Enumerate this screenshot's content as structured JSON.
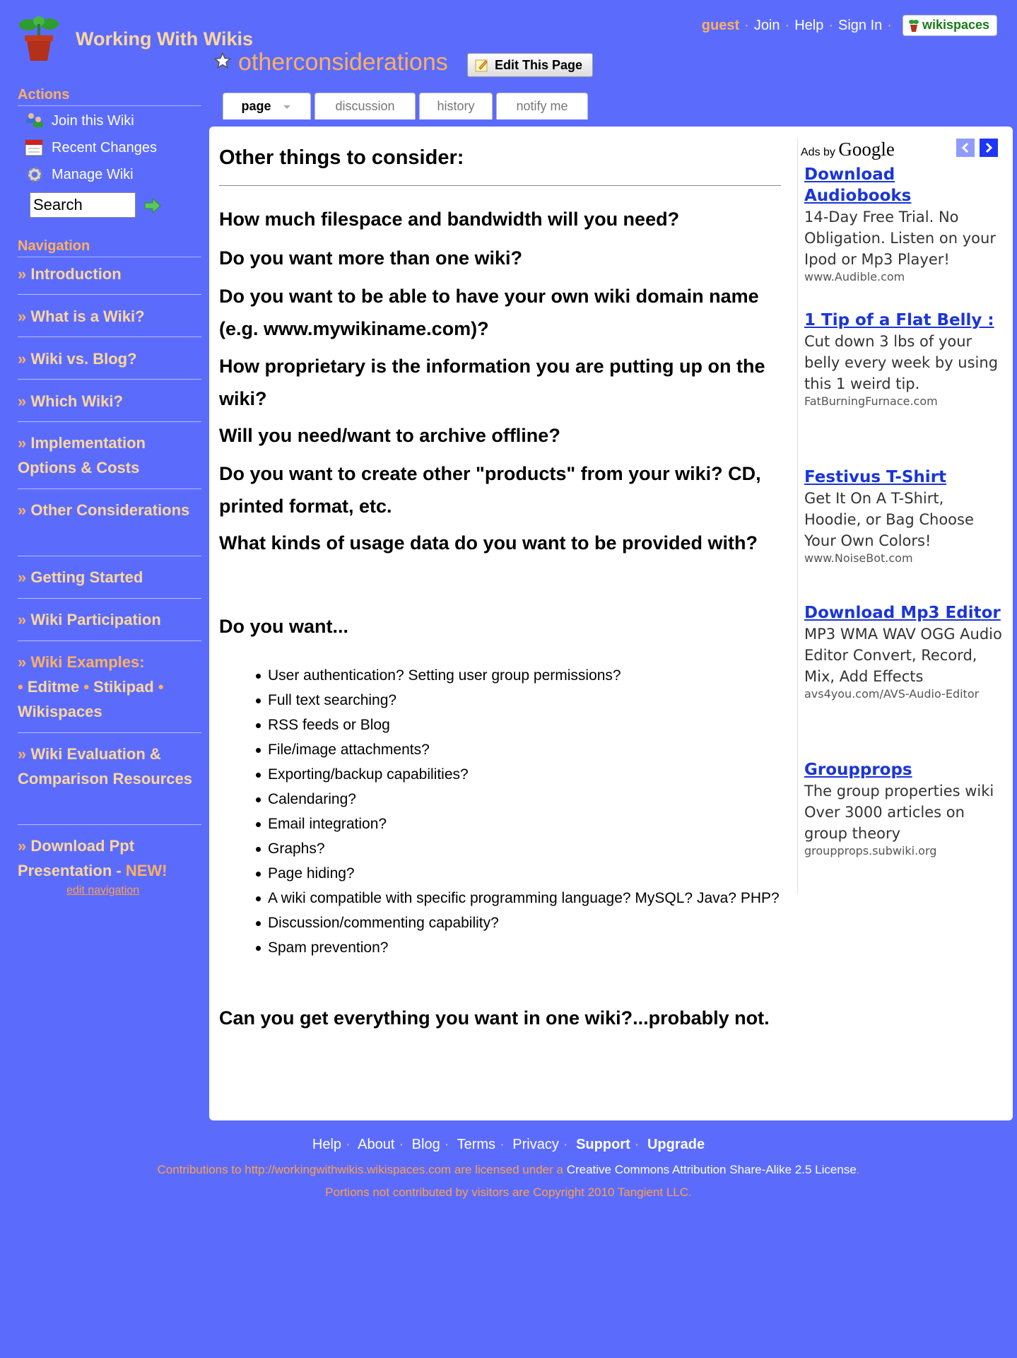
{
  "header": {
    "site_title": "Working With Wikis",
    "guest": "guest",
    "join": "Join",
    "help": "Help",
    "sign_in": "Sign In",
    "wikispaces": "wikispaces",
    "page_name": "otherconsiderations",
    "edit_button": "Edit This Page"
  },
  "sidebar": {
    "actions_heading": "Actions",
    "actions": [
      {
        "label": "Join this Wiki",
        "icon": "people-icon"
      },
      {
        "label": "Recent Changes",
        "icon": "calendar-icon"
      },
      {
        "label": "Manage Wiki",
        "icon": "gear-icon"
      }
    ],
    "search_value": "Search",
    "navigation_heading": "Navigation",
    "nav": [
      {
        "arrow": "»",
        "label": "Introduction"
      },
      {
        "arrow": "»",
        "label": "What is a Wiki?"
      },
      {
        "arrow": "»",
        "label": "Wiki vs. Blog?"
      },
      {
        "arrow": "»",
        "label": "Which Wiki?"
      },
      {
        "arrow": "»",
        "label": "Implementation Options & Costs"
      },
      {
        "arrow": "»",
        "label": "Other Considerations"
      },
      {
        "arrow": "»",
        "label": "Getting Started"
      },
      {
        "arrow": "»",
        "label": "Wiki Participation"
      },
      {
        "arrow": "»",
        "label": "Wiki Examples:"
      },
      {
        "arrow": "»",
        "label": "Wiki Evaluation & Comparison Resources"
      },
      {
        "arrow": "»",
        "label": "Download Ppt Presentation - "
      }
    ],
    "examples": [
      "Editme",
      "Stikipad",
      "Wikispaces"
    ],
    "bullet": "•",
    "new_badge": "NEW!",
    "edit_navigation": "edit navigation"
  },
  "tabs": [
    {
      "label": "page",
      "active": true
    },
    {
      "label": "discussion",
      "active": false
    },
    {
      "label": "history",
      "active": false
    },
    {
      "label": "notify me",
      "active": false
    }
  ],
  "main": {
    "heading": "Other things to consider:",
    "questions": [
      "How much filespace and bandwidth will you need?",
      "Do you want more than one wiki?",
      "Do you want to be able to have your own wiki domain name (e.g. www.mywikiname.com)?",
      "How proprietary is the information you are putting up on the wiki?",
      "Will you need/want to archive offline?",
      "Do you want to create other \"products\" from your wiki? CD, printed format, etc.",
      "What kinds of usage data do you want to be provided with?"
    ],
    "do_you_want": "Do you want...",
    "bullets": [
      "User authentication? Setting user group permissions?",
      "Full text searching?",
      "RSS feeds or Blog",
      "File/image attachments?",
      "Exporting/backup capabilities?",
      "Calendaring?",
      "Email integration?",
      "Graphs?",
      "Page hiding?",
      "A wiki compatible with specific programming language? MySQL? Java? PHP?",
      "Discussion/commenting capability?",
      "Spam prevention?"
    ],
    "closing": "Can you get everything you want in one wiki?...probably not."
  },
  "ads": {
    "ads_by": "Ads by",
    "google": "Google",
    "items": [
      {
        "title": "Download Audiobooks",
        "desc": "14-Day Free Trial. No Obligation. Listen on your Ipod or Mp3 Player!",
        "url": "www.Audible.com"
      },
      {
        "title": "1 Tip of a Flat Belly :",
        "desc": "Cut down 3 lbs of your belly every week by using this 1 weird tip.",
        "url": "FatBurningFurnace.com"
      },
      {
        "title": "Festivus T-Shirt",
        "desc": "Get It On A T-Shirt, Hoodie, or Bag Choose Your Own Colors!",
        "url": "www.NoiseBot.com"
      },
      {
        "title": "Download Mp3 Editor",
        "desc": "MP3 WMA WAV OGG Audio Editor Convert, Record, Mix, Add Effects",
        "url": "avs4you.com/AVS-Audio-Editor"
      },
      {
        "title": "Groupprops",
        "desc": "The group properties wiki Over 3000 articles on group theory",
        "url": "groupprops.subwiki.org"
      }
    ]
  },
  "footer": {
    "links": [
      "Help",
      "About",
      "Blog",
      "Terms",
      "Privacy",
      "Support",
      "Upgrade"
    ],
    "license_prefix": "Contributions to http://workingwithwikis.wikispaces.com are licensed under a ",
    "license_link": "Creative Commons Attribution Share-Alike 2.5 License",
    "license_suffix": ".",
    "copyright": "Portions not contributed by visitors are Copyright 2010 Tangient LLC."
  },
  "colors": {
    "background": "#5b6cfd",
    "accent_orange": "#ffb060",
    "nav_text": "#ffd79a",
    "ad_link": "#1a35d8"
  }
}
